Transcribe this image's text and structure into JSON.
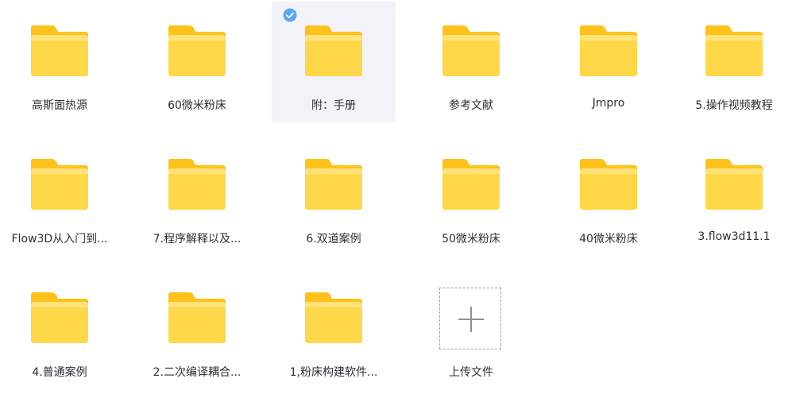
{
  "items": [
    {
      "label": "高斯面热源",
      "type": "folder",
      "selected": false
    },
    {
      "label": "60微米粉床",
      "type": "folder",
      "selected": false
    },
    {
      "label": "附：手册",
      "type": "folder",
      "selected": true
    },
    {
      "label": "参考文献",
      "type": "folder",
      "selected": false
    },
    {
      "label": "Jmpro",
      "type": "folder",
      "selected": false
    },
    {
      "label": "5.操作视频教程",
      "type": "folder",
      "selected": false
    },
    {
      "label": "Flow3D从入门到...",
      "type": "folder",
      "selected": false
    },
    {
      "label": "7.程序解释以及...",
      "type": "folder",
      "selected": false
    },
    {
      "label": "6.双道案例",
      "type": "folder",
      "selected": false
    },
    {
      "label": "50微米粉床",
      "type": "folder",
      "selected": false
    },
    {
      "label": "40微米粉床",
      "type": "folder",
      "selected": false
    },
    {
      "label": "3.flow3d11.1",
      "type": "folder",
      "selected": false
    },
    {
      "label": "4.普通案例",
      "type": "folder",
      "selected": false
    },
    {
      "label": "2.二次编译耦合...",
      "type": "folder",
      "selected": false
    },
    {
      "label": "1,粉床构建软件...",
      "type": "folder",
      "selected": false
    }
  ],
  "upload": {
    "label": "上传文件",
    "icon": "plus-icon"
  },
  "colors": {
    "folder_back": "#ffc21a",
    "folder_front": "#ffd84a",
    "selected_bg": "#f1f3f8",
    "check": "#5ba8f5"
  }
}
